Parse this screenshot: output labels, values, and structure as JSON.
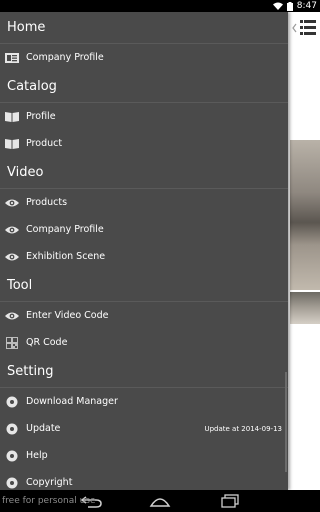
{
  "status_bar": {
    "time": "8:47"
  },
  "drawer": {
    "sections": [
      {
        "title": "Home",
        "items": [
          {
            "label": "Company Profile",
            "icon": "profile-card-icon"
          }
        ]
      },
      {
        "title": "Catalog",
        "items": [
          {
            "label": "Profile",
            "icon": "book-icon"
          },
          {
            "label": "Product",
            "icon": "book-icon"
          }
        ]
      },
      {
        "title": "Video",
        "items": [
          {
            "label": "Products",
            "icon": "eye-icon"
          },
          {
            "label": "Company Profile",
            "icon": "eye-icon"
          },
          {
            "label": "Exhibition Scene",
            "icon": "eye-icon"
          }
        ]
      },
      {
        "title": "Tool",
        "items": [
          {
            "label": "Enter Video Code",
            "icon": "eye-icon"
          },
          {
            "label": "QR Code",
            "icon": "qr-code-icon"
          }
        ]
      },
      {
        "title": "Setting",
        "items": [
          {
            "label": "Download Manager",
            "icon": "gear-icon",
            "extra": ""
          },
          {
            "label": "Update",
            "icon": "gear-icon",
            "extra": "Update at 2014-09-13"
          },
          {
            "label": "Help",
            "icon": "gear-icon",
            "extra": ""
          },
          {
            "label": "Copyright",
            "icon": "gear-icon",
            "extra": ""
          }
        ]
      }
    ]
  },
  "watermark": "free for personal use",
  "colors": {
    "drawer_bg": "#4a4a4a",
    "status_bar": "#000000",
    "divider": "#5a5a5a"
  }
}
